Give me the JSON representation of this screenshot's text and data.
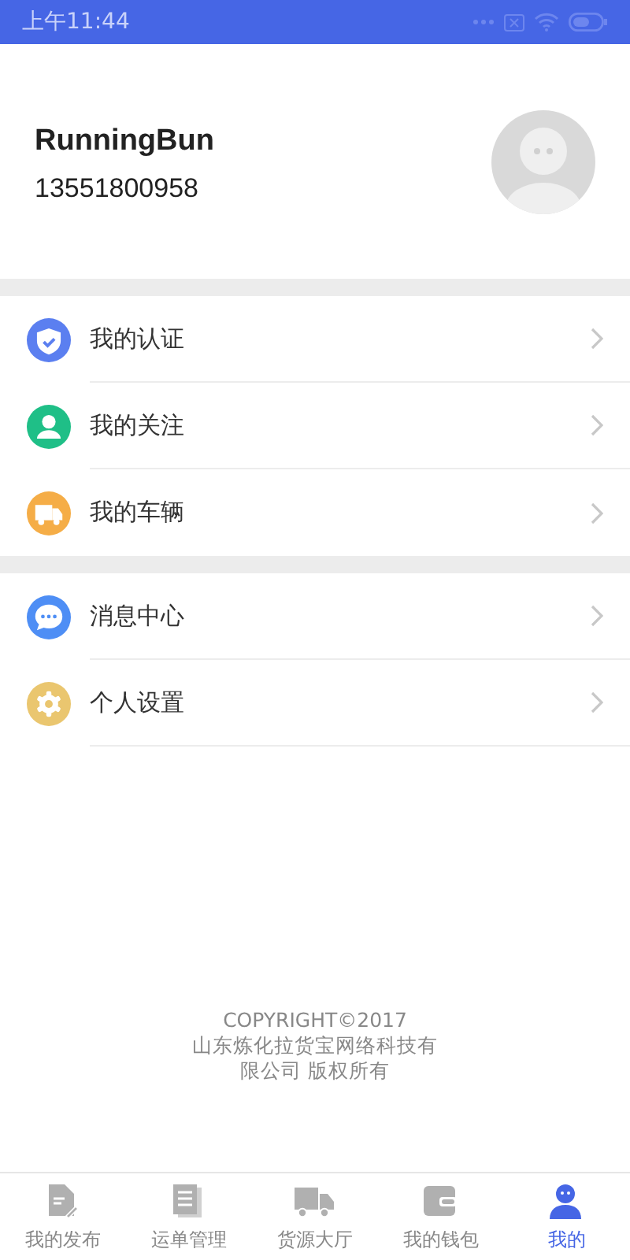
{
  "status_bar": {
    "time": "上午11:44"
  },
  "profile": {
    "name": "RunningBun",
    "phone": "13551800958"
  },
  "menu_groups": [
    {
      "items": [
        {
          "label": "我的认证",
          "color": "#5b7ff0"
        },
        {
          "label": "我的关注",
          "color": "#1fbf87"
        },
        {
          "label": "我的车辆",
          "color": "#f5ad47"
        }
      ]
    },
    {
      "items": [
        {
          "label": "消息中心",
          "color": "#4e8ef5"
        },
        {
          "label": "个人设置",
          "color": "#eac66f"
        }
      ]
    }
  ],
  "footer": {
    "copyright": "COPYRIGHT©2017",
    "company": "山东炼化拉货宝网络科技有",
    "rights": "限公司 版权所有"
  },
  "tabs": [
    {
      "label": "我的发布",
      "selected": false
    },
    {
      "label": "运单管理",
      "selected": false
    },
    {
      "label": "货源大厅",
      "selected": false
    },
    {
      "label": "我的钱包",
      "selected": false
    },
    {
      "label": "我的",
      "selected": true
    }
  ]
}
